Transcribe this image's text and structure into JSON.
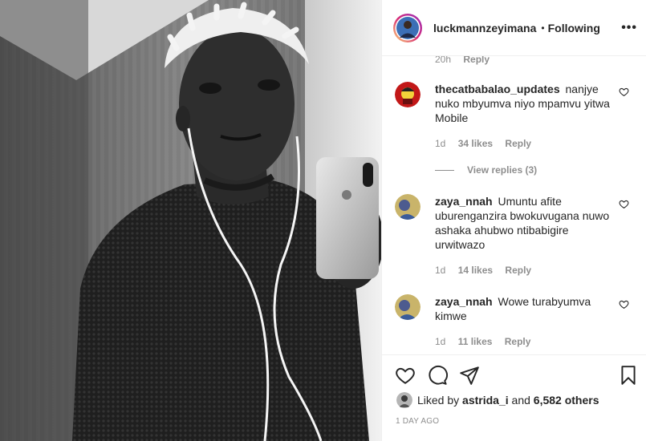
{
  "post": {
    "username": "luckmannzeyimana",
    "separator": "•",
    "follow_status": "Following",
    "more_label": "•••"
  },
  "previous_comment_meta": {
    "time": "20h",
    "reply_label": "Reply"
  },
  "comments": [
    {
      "username": "thecatbabalao_updates",
      "text": "nanjye nuko mbyumva niyo mpamvu yitwa Mobile",
      "time": "1d",
      "likes": "34 likes",
      "reply_label": "Reply"
    },
    {
      "username": "zaya_nnah",
      "text": "Umuntu afite uburenganzira bwokuvugana nuwo ashaka ahubwo ntibabigire urwitwazo",
      "time": "1d",
      "likes": "14 likes",
      "reply_label": "Reply"
    },
    {
      "username": "zaya_nnah",
      "text": "Wowe turabyumva kimwe",
      "time": "1d",
      "likes": "11 likes",
      "reply_label": "Reply"
    }
  ],
  "view_replies_label": "View replies (3)",
  "liked_by": {
    "prefix": "Liked by",
    "user": "astrida_i",
    "connector": "and",
    "others": "6,582 others"
  },
  "posted_time": "1 DAY AGO",
  "icons": {
    "like": "heart-icon",
    "comment": "comment-icon",
    "share": "share-icon",
    "save": "bookmark-icon",
    "comment_like": "heart-outline-icon"
  },
  "colors": {
    "text": "#262626",
    "muted": "#8e8e8e",
    "border": "#efefef"
  }
}
